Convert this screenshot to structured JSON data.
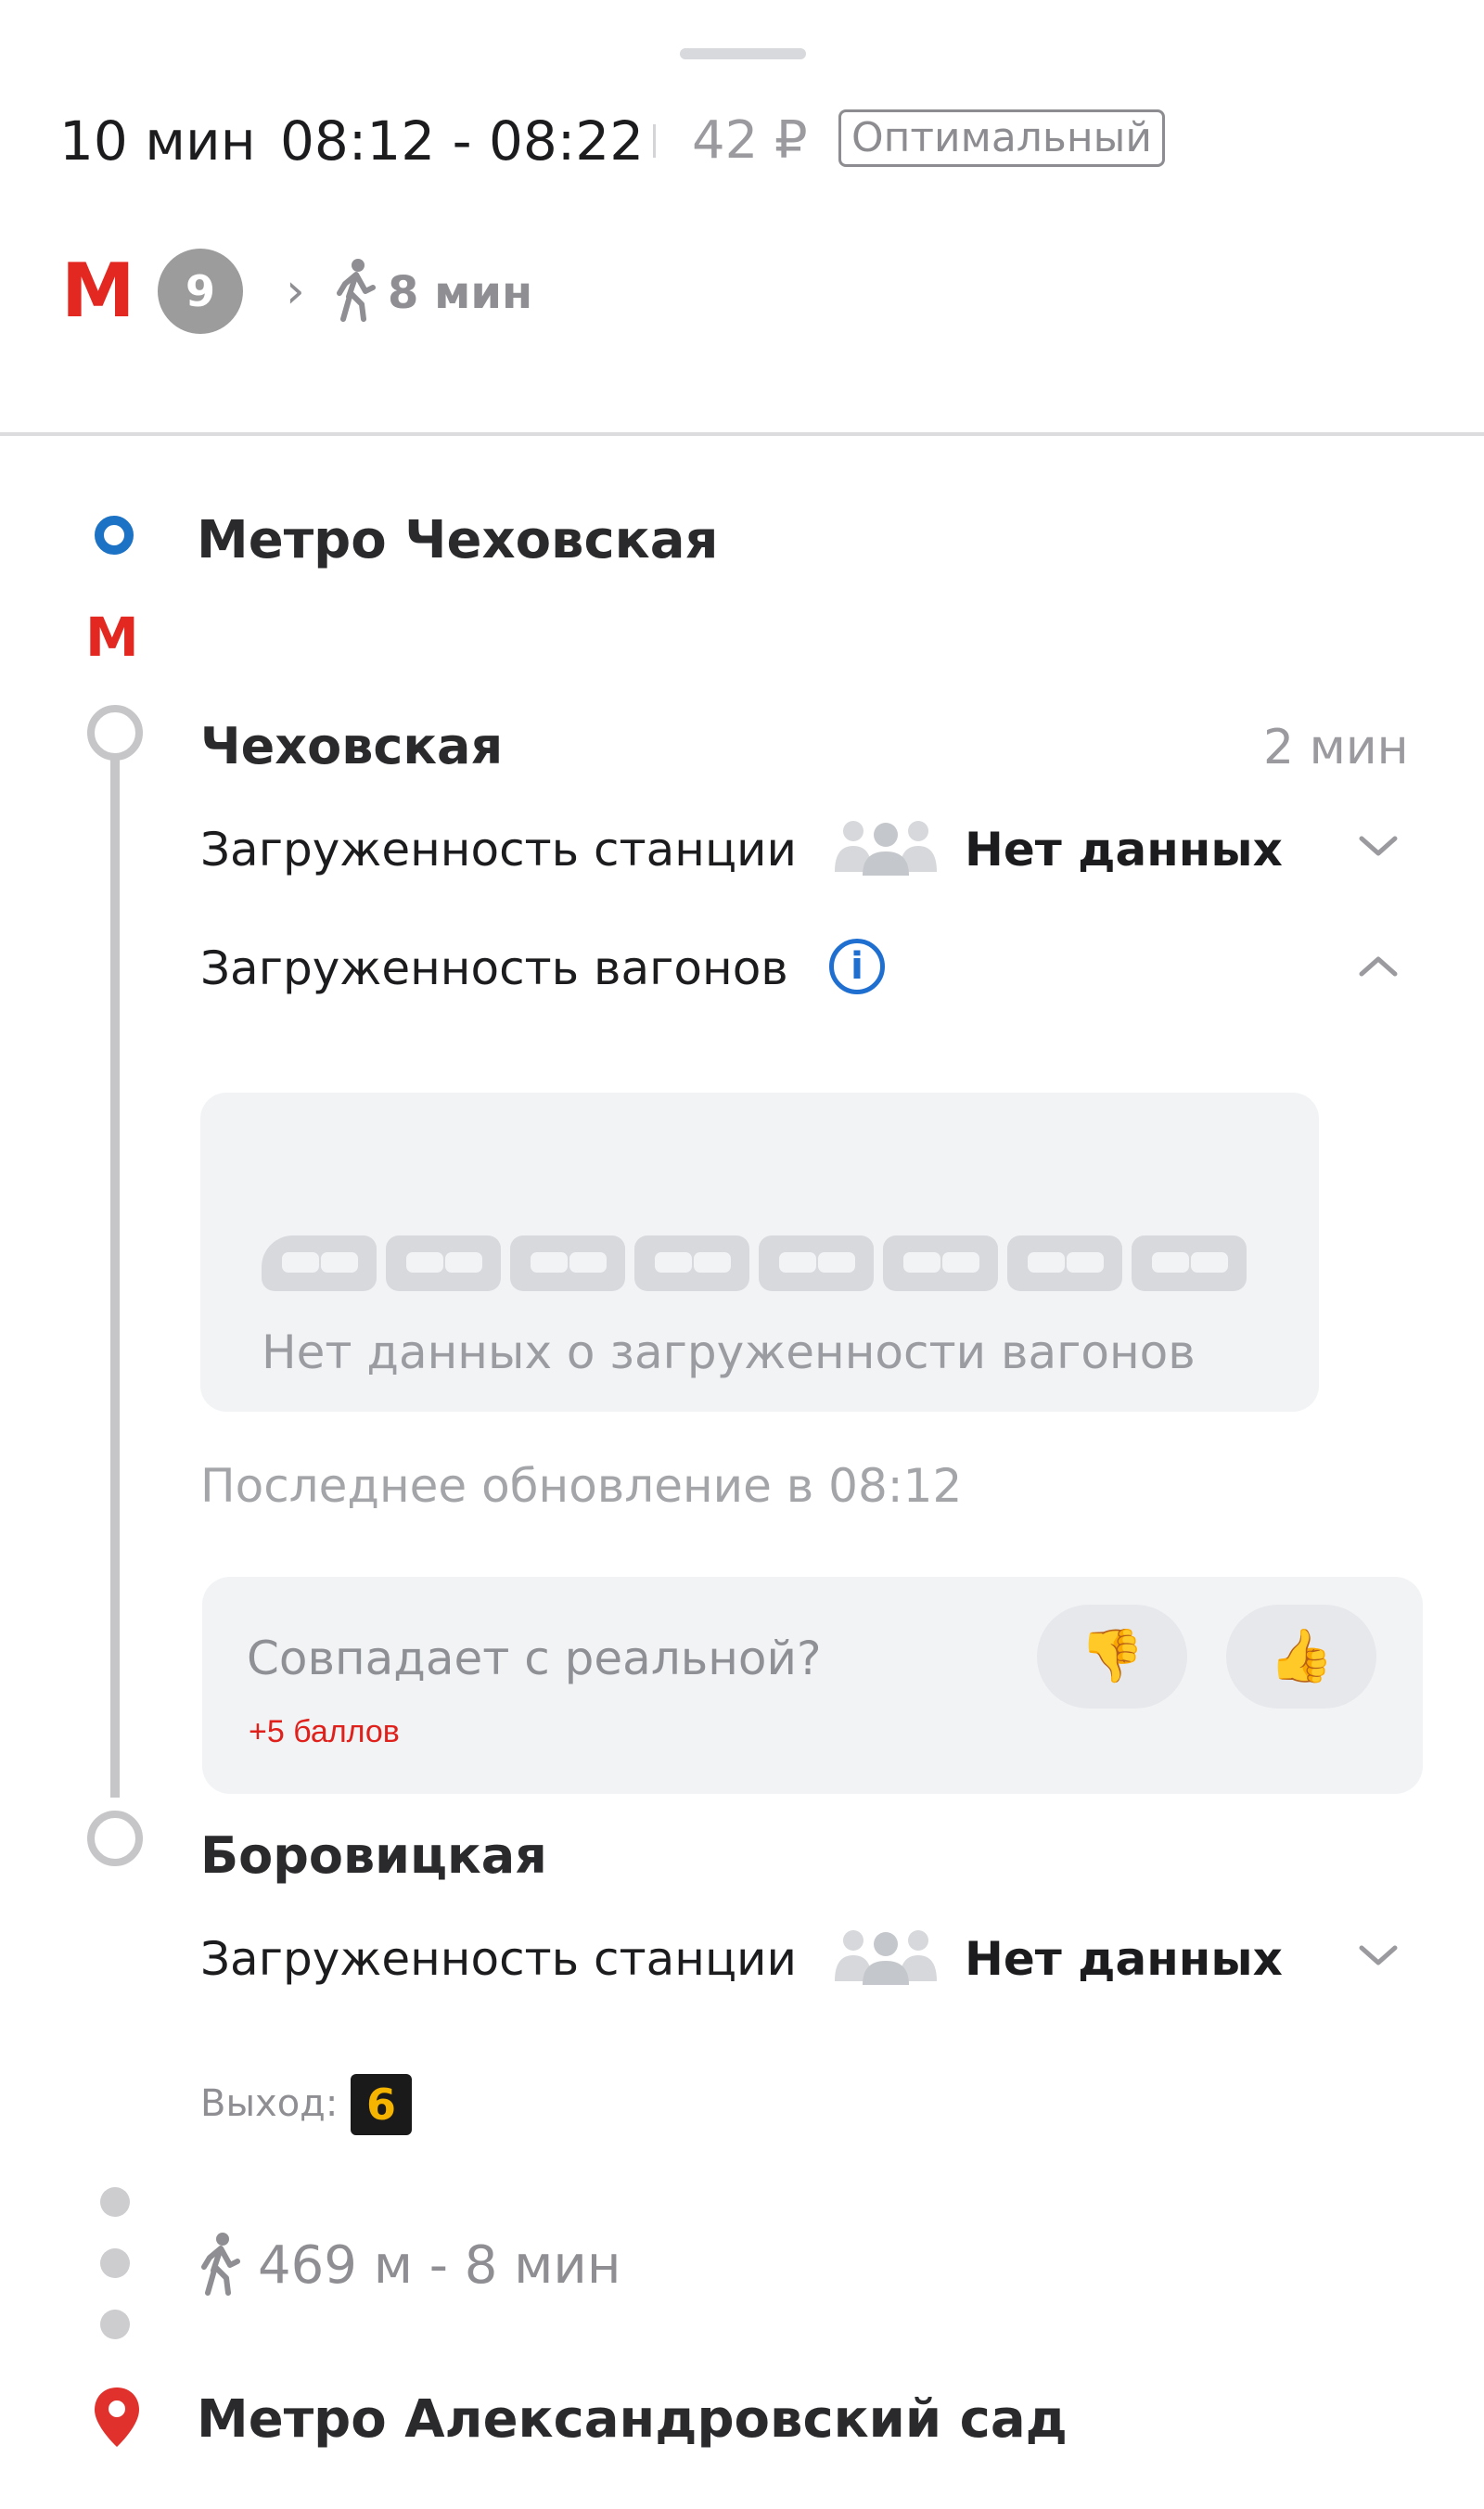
{
  "header": {
    "duration": "10 мин",
    "time_range": "08:12 - 08:22",
    "price": "42 ₽",
    "badge": "Оптимальный"
  },
  "summary": {
    "metro_logo": "M",
    "line_number": "9",
    "walk": "8 мин"
  },
  "origin": {
    "title": "Метро Чеховская"
  },
  "segment": {
    "from_station": {
      "name": "Чеховская",
      "duration": "2 мин",
      "station_load_label": "Загруженность станции",
      "station_load_value": "Нет данных",
      "car_load_label": "Загруженность вагонов"
    },
    "cars": {
      "count": 8,
      "message": "Нет данных о загруженности вагонов"
    },
    "last_update": "Последнее обновление в 08:12",
    "feedback": {
      "question": "Совпадает с реальной?",
      "points": "+5 баллов",
      "dislike_icon": "👎",
      "like_icon": "👍"
    },
    "to_station": {
      "name": "Боровицкая",
      "station_load_label": "Загруженность станции",
      "station_load_value": "Нет данных",
      "exit_label": "Выход:",
      "exit_number": "6"
    }
  },
  "walk": {
    "text": "469 м - 8 мин"
  },
  "destination": {
    "title": "Метро Александровский сад"
  },
  "colors": {
    "metro_red": "#e32822",
    "info_blue": "#1f6fd1",
    "origin_blue": "#1c72c4",
    "line_gray": "#c6c6c8"
  }
}
